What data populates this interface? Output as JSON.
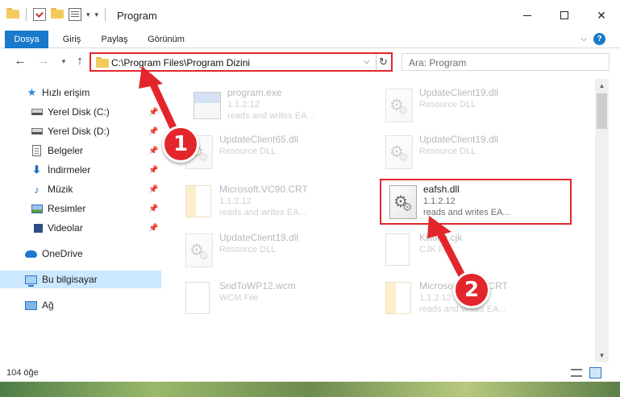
{
  "window": {
    "title": "Program"
  },
  "ribbon": {
    "tabs": [
      "Dosya",
      "Giriş",
      "Paylaş",
      "Görünüm"
    ]
  },
  "address": {
    "path": "C:\\Program Files\\Program Dizini"
  },
  "search": {
    "placeholder": "Ara: Program"
  },
  "sidebar": {
    "items": [
      {
        "label": "Hızlı erişim",
        "icon": "star-icon"
      },
      {
        "label": "Yerel Disk (C:)",
        "icon": "drive-icon",
        "pinned": true
      },
      {
        "label": "Yerel Disk (D:)",
        "icon": "drive-icon",
        "pinned": true
      },
      {
        "label": "Belgeler",
        "icon": "document-icon",
        "pinned": true
      },
      {
        "label": "İndirmeler",
        "icon": "download-icon",
        "pinned": true
      },
      {
        "label": "Müzik",
        "icon": "music-icon",
        "pinned": true
      },
      {
        "label": "Resimler",
        "icon": "pictures-icon",
        "pinned": true
      },
      {
        "label": "Videolar",
        "icon": "videos-icon",
        "pinned": true
      },
      {
        "label": "OneDrive",
        "icon": "cloud-icon"
      },
      {
        "label": "Bu bilgisayar",
        "icon": "computer-icon",
        "selected": true
      },
      {
        "label": "Ağ",
        "icon": "network-icon"
      }
    ]
  },
  "files": [
    {
      "name": "program.exe",
      "meta1": "1.1.2.12",
      "meta2": "reads and writes EA...",
      "icon": "exe-icon",
      "faded": true
    },
    {
      "name": "UpdateClient19.dll",
      "meta1": "Resource DLL",
      "meta2": "",
      "icon": "dll-icon",
      "faded": true
    },
    {
      "name": "UpdateClient65.dll",
      "meta1": "Resource DLL",
      "meta2": "",
      "icon": "dll-icon",
      "faded": true
    },
    {
      "name": "UpdateClient19.dll",
      "meta1": "Resource DLL",
      "meta2": "",
      "icon": "dll-icon",
      "faded": true
    },
    {
      "name": "Microsoft.VC90.CRT",
      "meta1": "1.1.2.12",
      "meta2": "reads and writes EA...",
      "icon": "manifest-icon",
      "faded": true
    },
    {
      "name": "eafsh.dll",
      "meta1": "1.1.2.12",
      "meta2": "reads and writes EA...",
      "icon": "dll-icon",
      "faded": false
    },
    {
      "name": "UpdateClient19.dll",
      "meta1": "Resource DLL",
      "meta2": "",
      "icon": "dll-icon",
      "faded": true
    },
    {
      "name": "Kilitlen.cjk",
      "meta1": "CJK File",
      "meta2": "",
      "icon": "blank-file-icon",
      "faded": true
    },
    {
      "name": "SndToWP12.wcm",
      "meta1": "WCM File",
      "meta2": "",
      "icon": "blank-file-icon",
      "faded": true
    },
    {
      "name": "Microsoft.VC90.CRT",
      "meta1": "1.1.2.12",
      "meta2": "reads and writes EA...",
      "icon": "manifest-icon",
      "faded": true
    }
  ],
  "status": {
    "count": "104 öğe"
  },
  "annotations": {
    "step1": "1",
    "step2": "2",
    "color": "#e2262b"
  },
  "colors": {
    "accent": "#1979ca",
    "selection": "#cce8ff"
  }
}
